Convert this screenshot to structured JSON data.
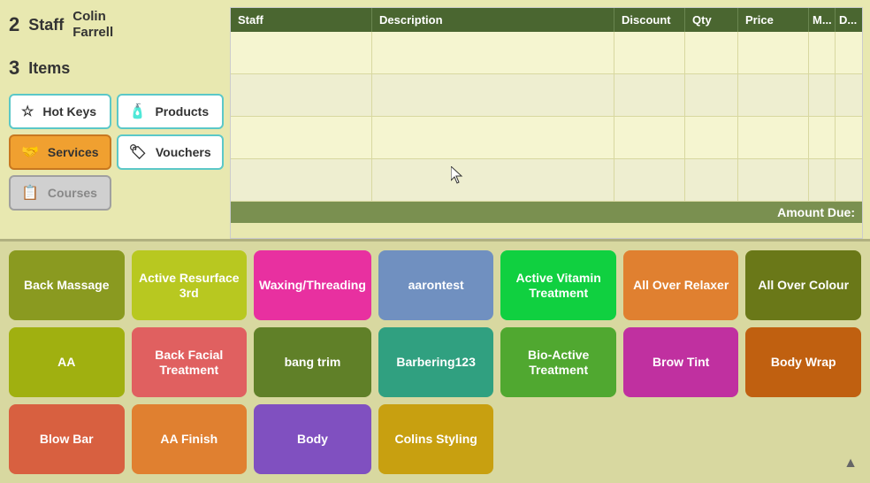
{
  "header": {
    "step2_number": "2",
    "step2_label": "Staff",
    "staff_name_line1": "Colin",
    "staff_name_line2": "Farrell",
    "step3_number": "3",
    "step3_label": "Items"
  },
  "buttons": {
    "hotkeys": "Hot Keys",
    "services": "Services",
    "products": "Products",
    "courses": "Courses",
    "vouchers": "Vouchers"
  },
  "table": {
    "columns": {
      "staff": "Staff",
      "description": "Description",
      "discount": "Discount",
      "qty": "Qty",
      "price": "Price",
      "m": "M...",
      "d": "D..."
    },
    "amount_due_label": "Amount Due:"
  },
  "hotkeys": [
    {
      "label": "Back Massage",
      "color": "color-olive"
    },
    {
      "label": "Active Resurface 3rd",
      "color": "color-lime"
    },
    {
      "label": "Waxing/Threading",
      "color": "color-pink"
    },
    {
      "label": "aarontest",
      "color": "color-blue-gray"
    },
    {
      "label": "Active Vitamin Treatment",
      "color": "color-green"
    },
    {
      "label": "All Over Relaxer",
      "color": "color-orange"
    },
    {
      "label": "All Over Colour",
      "color": "color-dark-olive"
    },
    {
      "label": "AA",
      "color": "color-yellow-green"
    },
    {
      "label": "Back Facial Treatment",
      "color": "color-salmon"
    },
    {
      "label": "bang trim",
      "color": "color-dark-green"
    },
    {
      "label": "Barbering123",
      "color": "color-teal"
    },
    {
      "label": "Bio-Active Treatment",
      "color": "color-green-light"
    },
    {
      "label": "Brow Tint",
      "color": "color-magenta"
    },
    {
      "label": "Body Wrap",
      "color": "color-dark-orange"
    },
    {
      "label": "Blow Bar",
      "color": "color-coral"
    },
    {
      "label": "AA Finish",
      "color": "color-orange"
    },
    {
      "label": "Body",
      "color": "color-purple"
    },
    {
      "label": "Colins Styling",
      "color": "color-dark-yellow"
    }
  ]
}
